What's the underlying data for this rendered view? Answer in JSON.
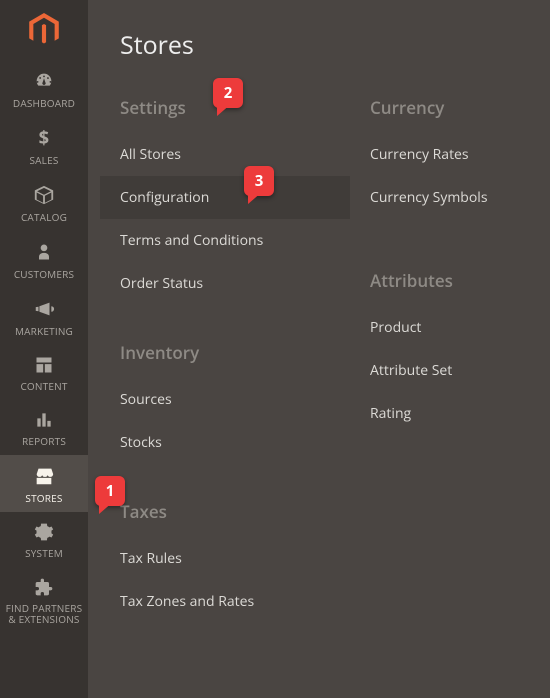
{
  "panel_title": "Stores",
  "sidebar": [
    {
      "label": "DASHBOARD"
    },
    {
      "label": "SALES"
    },
    {
      "label": "CATALOG"
    },
    {
      "label": "CUSTOMERS"
    },
    {
      "label": "MARKETING"
    },
    {
      "label": "CONTENT"
    },
    {
      "label": "REPORTS"
    },
    {
      "label": "STORES"
    },
    {
      "label": "SYSTEM"
    },
    {
      "label": "FIND PARTNERS\n& EXTENSIONS"
    }
  ],
  "groups": {
    "settings": {
      "header": "Settings",
      "items": [
        "All Stores",
        "Configuration",
        "Terms and Conditions",
        "Order Status"
      ]
    },
    "inventory": {
      "header": "Inventory",
      "items": [
        "Sources",
        "Stocks"
      ]
    },
    "taxes": {
      "header": "Taxes",
      "items": [
        "Tax Rules",
        "Tax Zones and Rates"
      ]
    },
    "currency": {
      "header": "Currency",
      "items": [
        "Currency Rates",
        "Currency Symbols"
      ]
    },
    "attributes": {
      "header": "Attributes",
      "items": [
        "Product",
        "Attribute Set",
        "Rating"
      ]
    }
  },
  "callouts": {
    "c1": "1",
    "c2": "2",
    "c3": "3"
  }
}
